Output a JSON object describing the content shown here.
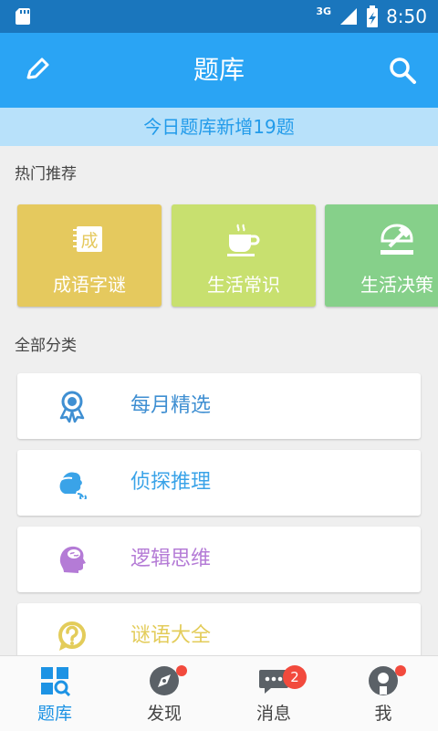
{
  "status_bar": {
    "network": "3G",
    "time": "8:50"
  },
  "app_bar": {
    "title": "题库",
    "edit_icon": "pencil-icon",
    "search_icon": "search-icon"
  },
  "banner": {
    "text": "今日题库新增19题"
  },
  "hot": {
    "label": "热门推荐",
    "items": [
      {
        "label": "成语字谜",
        "icon": "idiom-icon",
        "color": "#e5c95e"
      },
      {
        "label": "生活常识",
        "icon": "teacup-icon",
        "color": "#c8e06f"
      },
      {
        "label": "生活决策",
        "icon": "gavel-icon",
        "color": "#86d08a"
      }
    ]
  },
  "all": {
    "label": "全部分类",
    "items": [
      {
        "label": "每月精选",
        "icon": "award-ribbon-icon",
        "color": "#3f8fd2"
      },
      {
        "label": "侦探推理",
        "icon": "detective-icon",
        "color": "#3aa3e8"
      },
      {
        "label": "逻辑思维",
        "icon": "brain-head-icon",
        "color": "#b47bd6"
      },
      {
        "label": "谜语大全",
        "icon": "question-bubble-icon",
        "color": "#e3cc5a"
      }
    ]
  },
  "bottom_nav": {
    "items": [
      {
        "label": "题库",
        "icon": "question-bank-icon"
      },
      {
        "label": "发现",
        "icon": "compass-icon"
      },
      {
        "label": "消息",
        "icon": "chat-icon",
        "badge": "2"
      },
      {
        "label": "我",
        "icon": "profile-icon"
      }
    ]
  },
  "colors": {
    "primary": "#2aa4f4",
    "status_bar": "#1a76bd",
    "active_tab": "#1d93e4",
    "badge": "#f24a3d"
  }
}
